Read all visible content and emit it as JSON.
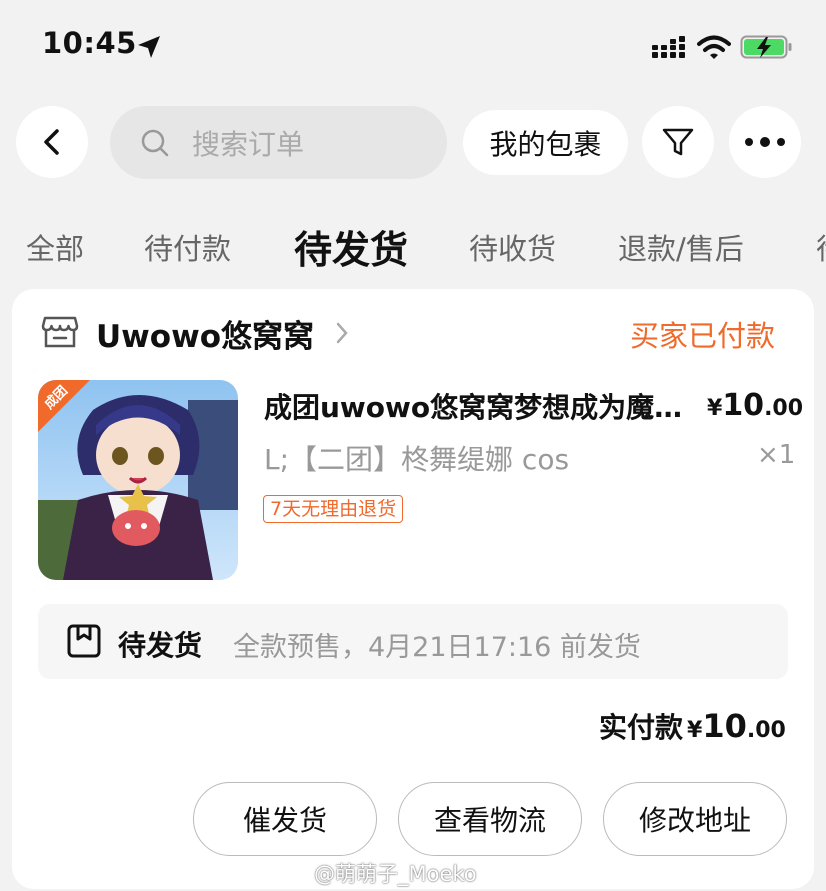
{
  "status_bar": {
    "time": "10:45"
  },
  "top_bar": {
    "search_placeholder": "搜索订单",
    "packages_label": "我的包裹"
  },
  "tabs": [
    {
      "label": "全部",
      "active": false
    },
    {
      "label": "待付款",
      "active": false
    },
    {
      "label": "待发货",
      "active": true
    },
    {
      "label": "待收货",
      "active": false
    },
    {
      "label": "退款/售后",
      "active": false
    },
    {
      "label": "待",
      "active": false
    }
  ],
  "order": {
    "shop_name": "Uwowo悠窝窝",
    "status": "买家已付款",
    "product": {
      "image_badge": "成团",
      "title": "成团uwowo悠窝窝梦想成为魔法少女 cos",
      "price_symbol": "¥",
      "price_int": "10",
      "price_dec": ".00",
      "sku": "L;【二团】柊舞缇娜 cos",
      "quantity": "×1",
      "return_policy": "7天无理由退货"
    },
    "shipping": {
      "status": "待发货",
      "note": "全款预售，4月21日17:16 前发货"
    },
    "paid": {
      "label": "实付款",
      "symbol": "¥",
      "int": "10",
      "dec": ".00"
    },
    "actions": {
      "remind": "催发货",
      "logistics": "查看物流",
      "address": "修改地址"
    }
  },
  "watermark": "@萌萌子_Moeko",
  "colors": {
    "accent": "#f06a2b",
    "background": "#f2f2f2",
    "battery_green": "#4cd964"
  }
}
